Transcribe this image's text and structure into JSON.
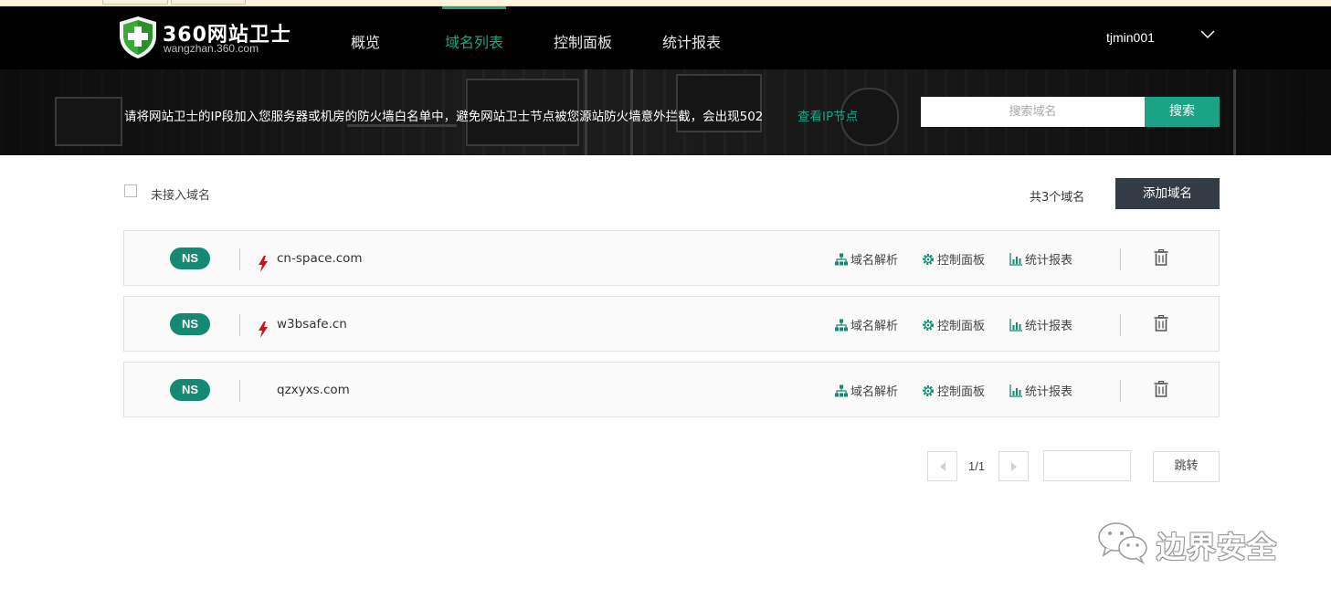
{
  "app": {
    "logo_title": "360网站卫士",
    "logo_subtitle": "wangzhan.360.com",
    "accent_color": "#1aa384",
    "badge_color": "#148a73"
  },
  "nav": {
    "items": [
      {
        "label": "概览",
        "active": false
      },
      {
        "label": "域名列表",
        "active": true
      },
      {
        "label": "控制面板",
        "active": false
      },
      {
        "label": "统计报表",
        "active": false
      }
    ],
    "user": "tjmin001",
    "user_menu_icon": "chevron-down-icon"
  },
  "banner": {
    "notice": "请将网站卫士的IP段加入您服务器或机房的防火墙白名单中，避免网站卫士节点被您源站防火墙意外拦截，会出现502",
    "notice_link": "查看IP节点",
    "search_placeholder": "搜索域名",
    "search_button": "搜索"
  },
  "toolbar": {
    "filter_label": "未接入域名",
    "total": "共3个域名",
    "add_button": "添加域名"
  },
  "domains": [
    {
      "badge": "NS",
      "name": "cn-space.com",
      "alert": true,
      "actions": {
        "dns": "域名解析",
        "panel": "控制面板",
        "stats": "统计报表"
      }
    },
    {
      "badge": "NS",
      "name": "w3bsafe.cn",
      "alert": true,
      "actions": {
        "dns": "域名解析",
        "panel": "控制面板",
        "stats": "统计报表"
      }
    },
    {
      "badge": "NS",
      "name": "qzxyxs.com",
      "alert": false,
      "actions": {
        "dns": "域名解析",
        "panel": "控制面板",
        "stats": "统计报表"
      }
    }
  ],
  "pagination": {
    "info": "1/1",
    "jump_button": "跳转",
    "page_input_value": ""
  },
  "watermark": {
    "text": "边界安全"
  }
}
